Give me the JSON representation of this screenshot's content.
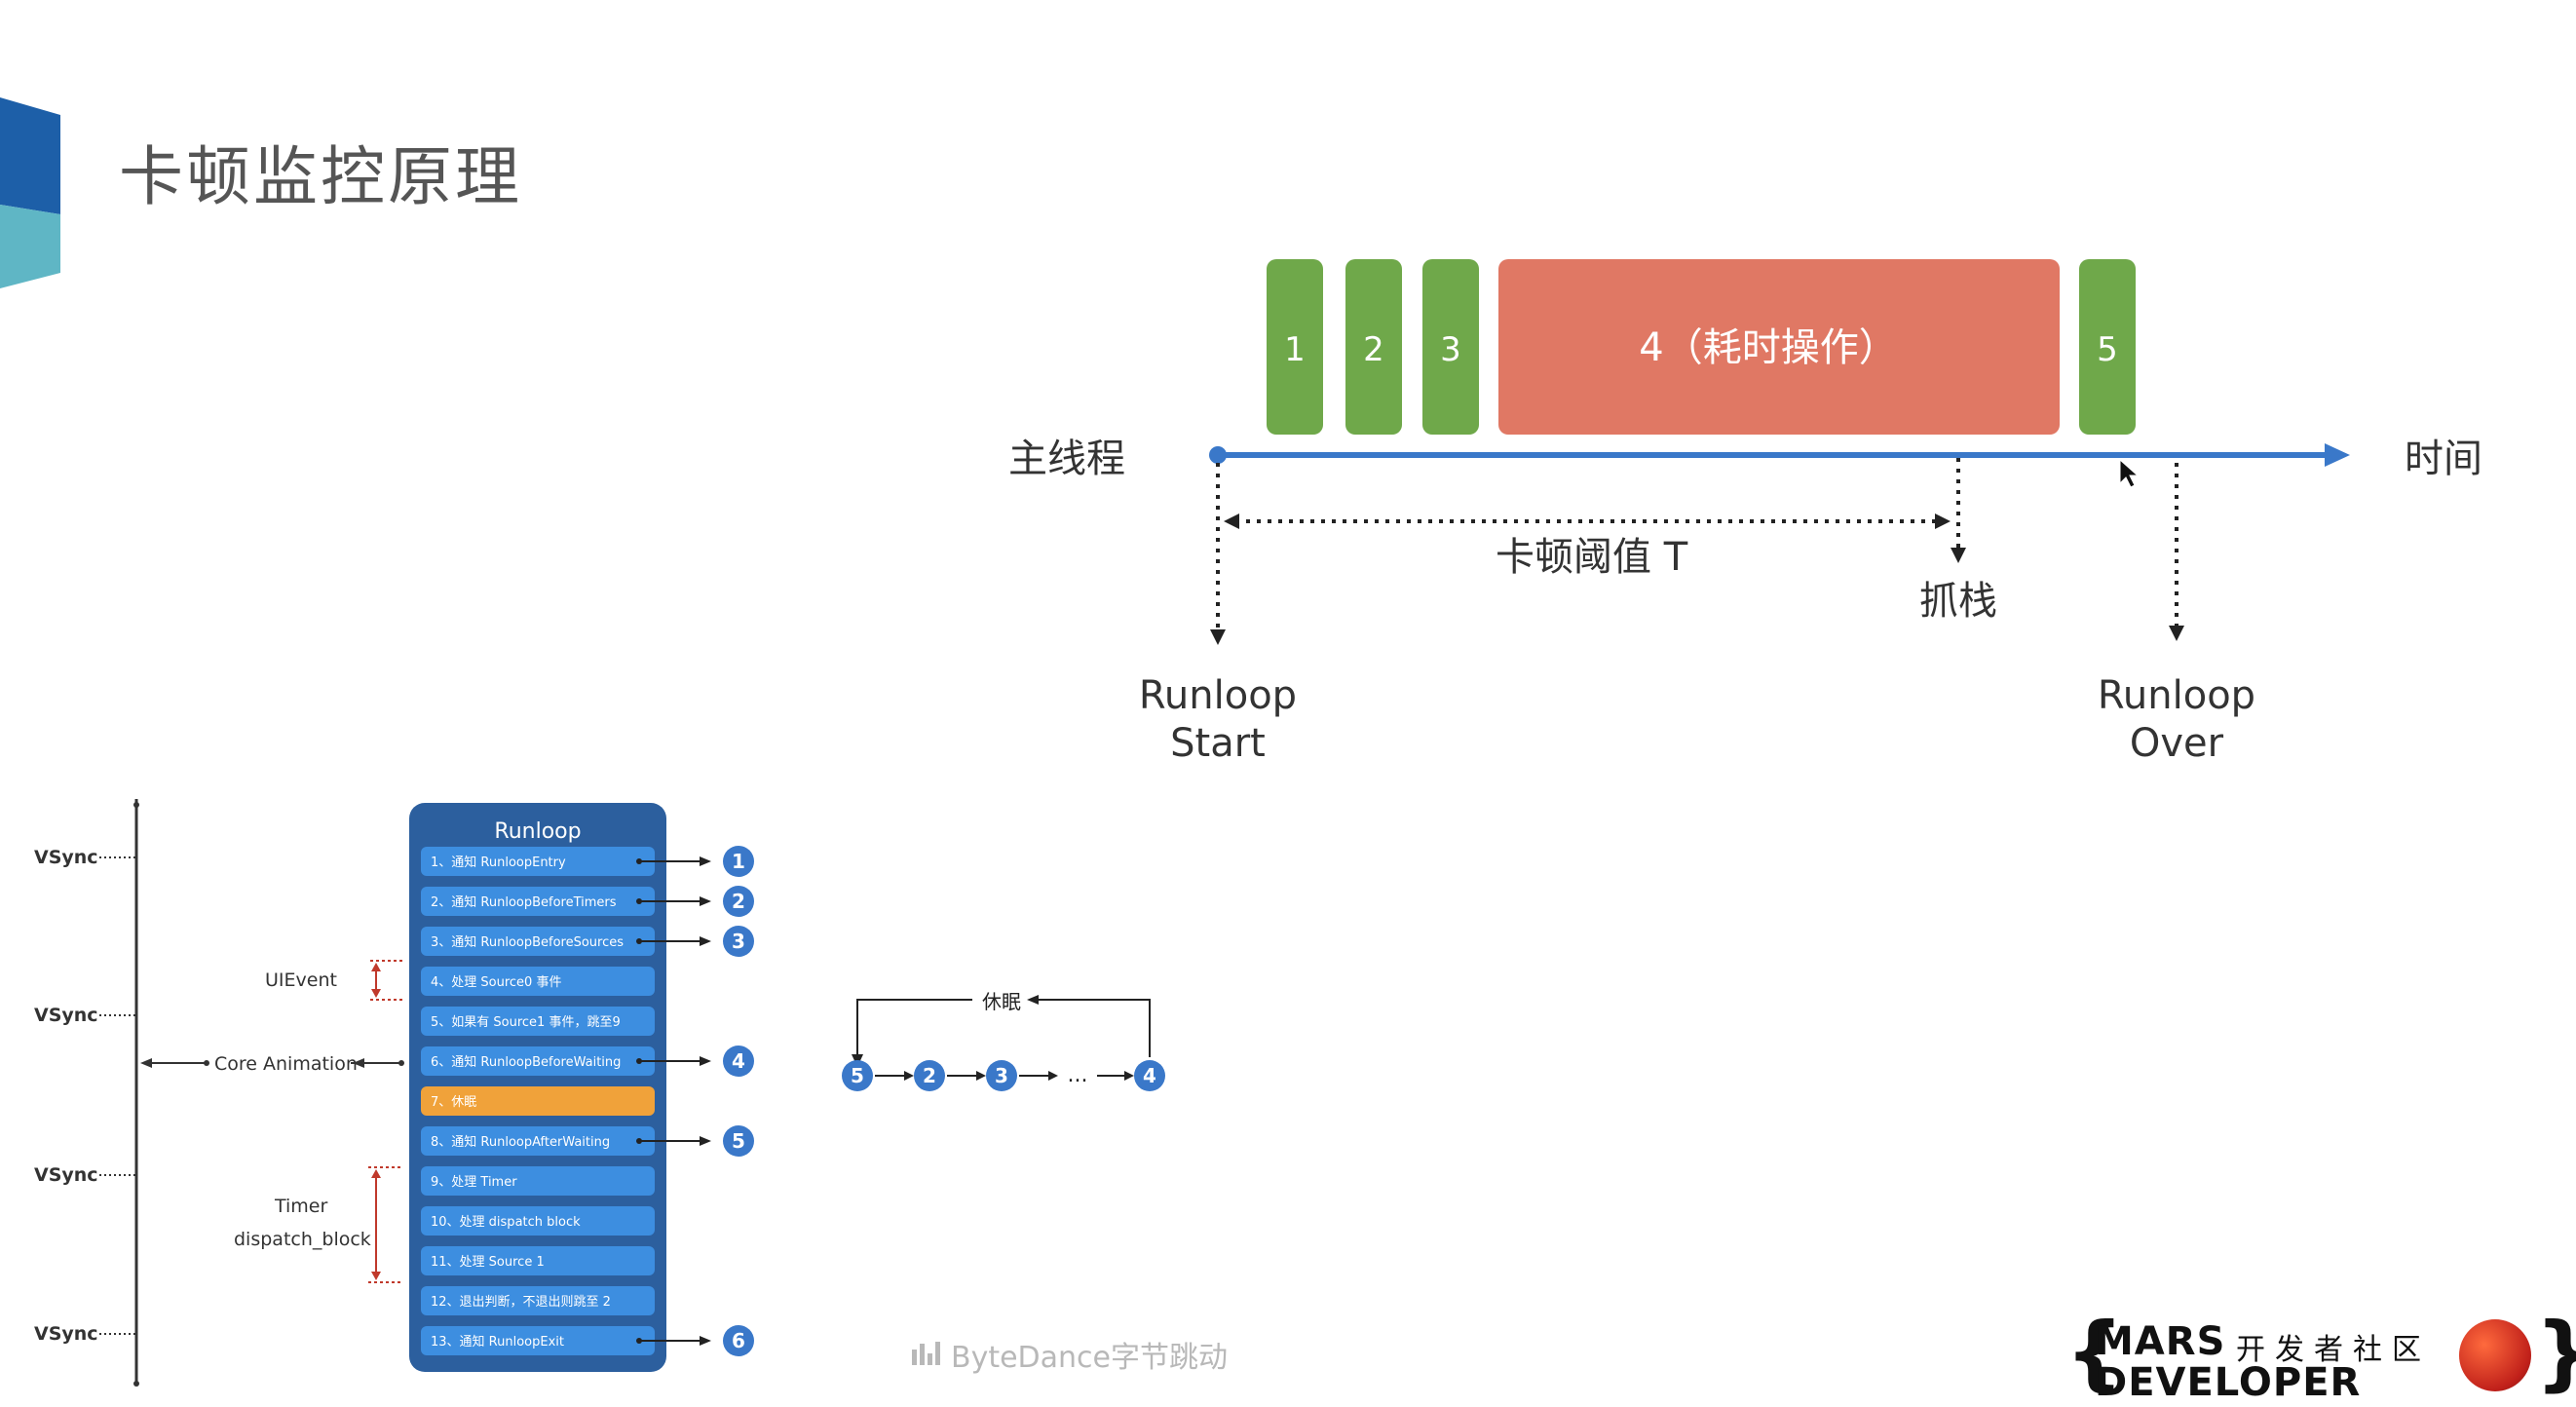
{
  "slide": {
    "title": "卡顿监控原理"
  },
  "timeline": {
    "thread_label": "主线程",
    "time_label": "时间",
    "blocks": [
      "1",
      "2",
      "3",
      "4（耗时操作）",
      "5"
    ],
    "threshold_label": "卡顿阈值 T",
    "grab_stack_label": "抓栈",
    "runloop_start": [
      "Runloop",
      "Start"
    ],
    "runloop_over": [
      "Runloop",
      "Over"
    ]
  },
  "runloop": {
    "title": "Runloop",
    "steps": [
      "1、通知 RunloopEntry",
      "2、通知 RunloopBeforeTimers",
      "3、通知 RunloopBeforeSources",
      "4、处理 Source0 事件",
      "5、如果有 Source1 事件，跳至9",
      "6、通知 RunloopBeforeWaiting",
      "7、休眠",
      "8、通知 RunloopAfterWaiting",
      "9、处理 Timer",
      "10、处理 dispatch block",
      "11、处理 Source 1",
      "12、退出判断，不退出则跳至 2",
      "13、通知 RunloopExit"
    ],
    "markers": [
      "1",
      "2",
      "3",
      "4",
      "5",
      "6"
    ],
    "vsync": "VSync",
    "uievent": "UIEvent",
    "core_animation": "Core Animation",
    "timer": "Timer",
    "dispatch_block": "dispatch_block"
  },
  "cycle": {
    "sleep_label": "休眠",
    "nodes": [
      "5",
      "2",
      "3",
      "...",
      "4"
    ]
  },
  "watermark": "ByteDance字节跳动",
  "brand": {
    "line1": "MARS",
    "line2": "DEVELOPER",
    "cn": "开发者社区"
  },
  "colors": {
    "green": "#6fa84a",
    "red": "#e07864",
    "blue": "#3a78c9",
    "step_blue": "#3d8ee0",
    "runloop_bg": "#2c5f9e",
    "orange": "#f0a23a"
  }
}
